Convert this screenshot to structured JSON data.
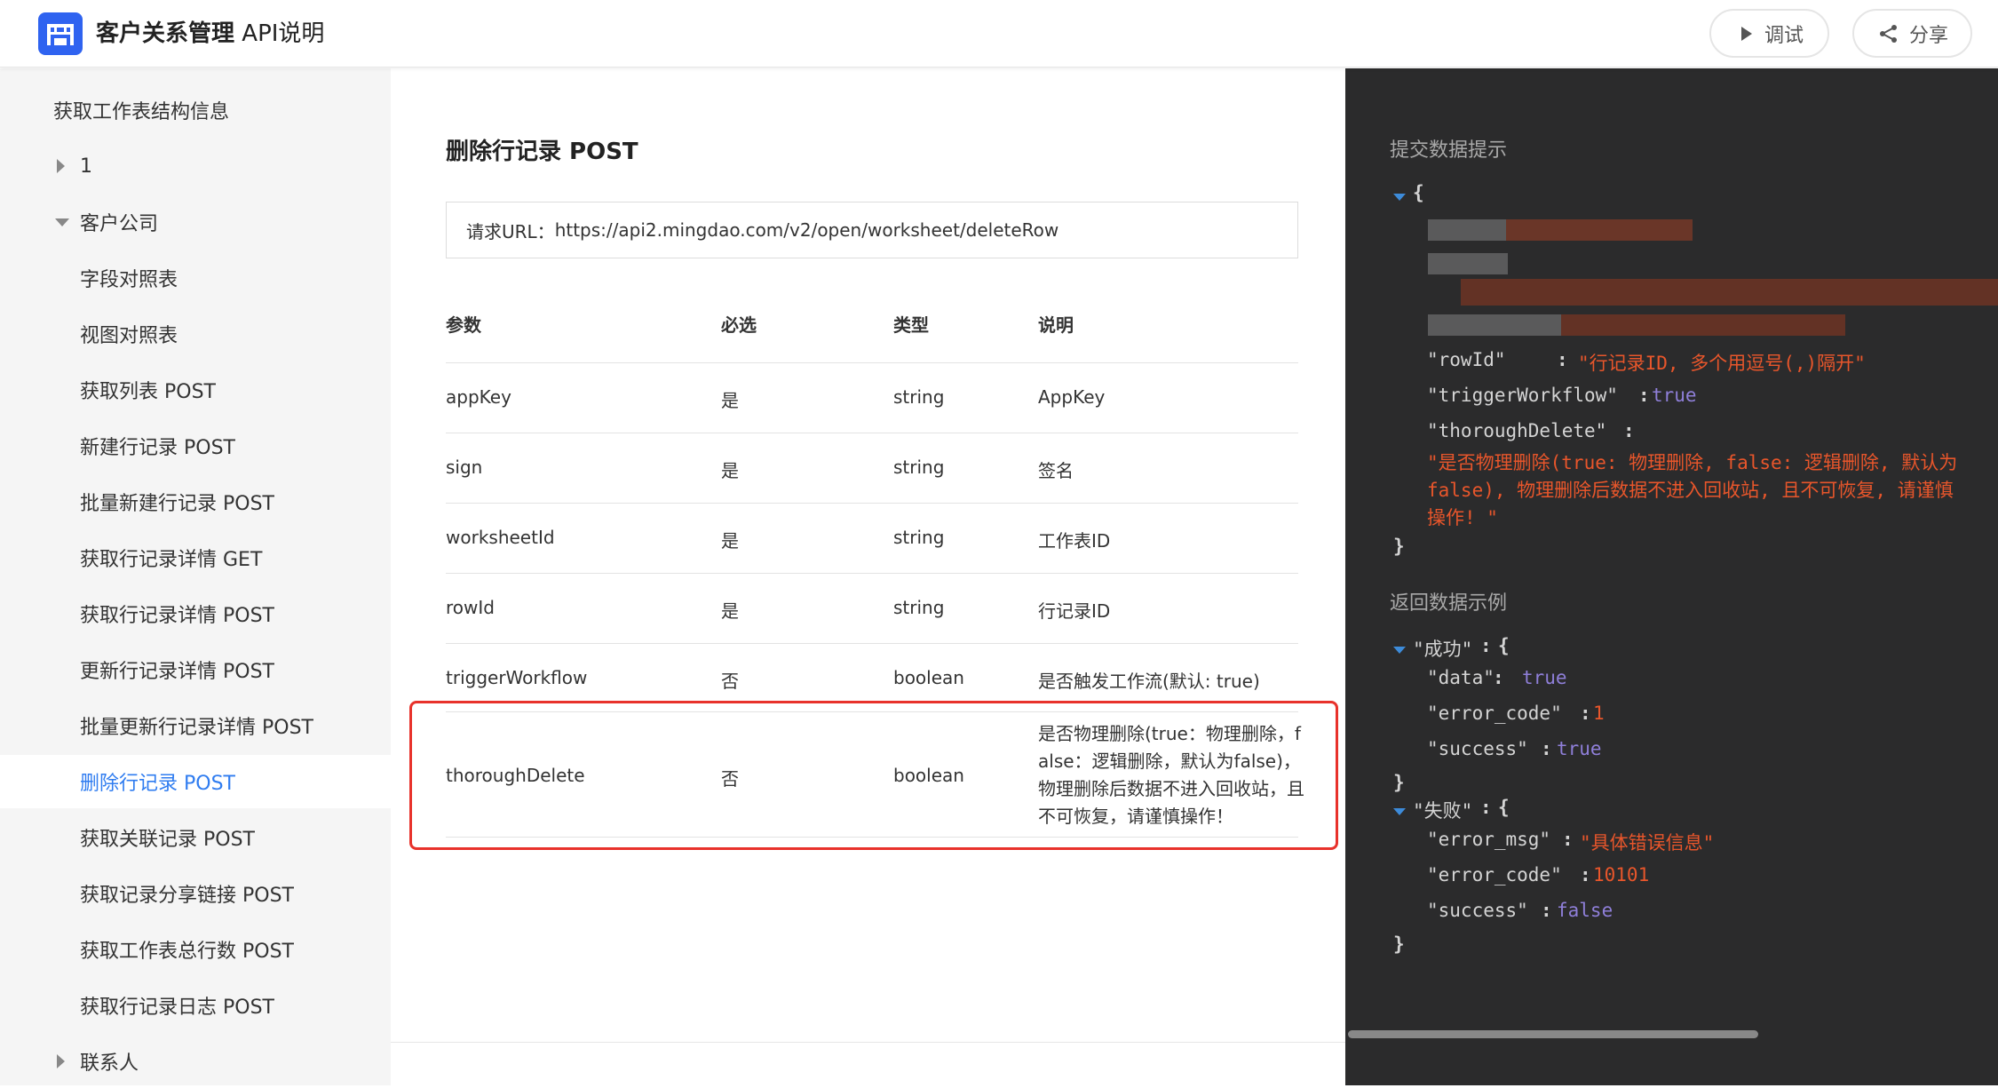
{
  "header": {
    "title_main": "客户关系管理",
    "title_sub": " API说明",
    "debug_label": "调试",
    "share_label": "分享"
  },
  "sidebar": {
    "items": [
      {
        "label": "获取工作表结构信息"
      },
      {
        "label": "1"
      },
      {
        "label": "客户公司"
      },
      {
        "label": "字段对照表"
      },
      {
        "label": "视图对照表"
      },
      {
        "label": "获取列表 POST"
      },
      {
        "label": "新建行记录 POST"
      },
      {
        "label": "批量新建行记录 POST"
      },
      {
        "label": "获取行记录详情 GET"
      },
      {
        "label": "获取行记录详情 POST"
      },
      {
        "label": "更新行记录详情 POST"
      },
      {
        "label": "批量更新行记录详情 POST"
      },
      {
        "label": "删除行记录 POST"
      },
      {
        "label": "获取关联记录 POST"
      },
      {
        "label": "获取记录分享链接 POST"
      },
      {
        "label": "获取工作表总行数 POST"
      },
      {
        "label": "获取行记录日志 POST"
      },
      {
        "label": "联系人"
      }
    ]
  },
  "main": {
    "title": "删除行记录 POST",
    "url_label": "请求URL：",
    "url": "https://api2.mingdao.com/v2/open/worksheet/deleteRow",
    "columns": [
      "参数",
      "必选",
      "类型",
      "说明"
    ],
    "rows": [
      {
        "param": "appKey",
        "required": "是",
        "type": "string",
        "desc": "AppKey"
      },
      {
        "param": "sign",
        "required": "是",
        "type": "string",
        "desc": "签名"
      },
      {
        "param": "worksheetId",
        "required": "是",
        "type": "string",
        "desc": "工作表ID"
      },
      {
        "param": "rowId",
        "required": "是",
        "type": "string",
        "desc": "行记录ID"
      },
      {
        "param": "triggerWorkflow",
        "required": "否",
        "type": "boolean",
        "desc": "是否触发工作流(默认: true)"
      },
      {
        "param": "thoroughDelete",
        "required": "否",
        "type": "boolean",
        "desc": "是否物理删除(true：物理删除，false：逻辑删除，默认为false)，物理删除后数据不进入回收站，且不可恢复，请谨慎操作！"
      }
    ]
  },
  "code": {
    "submit_label": "提交数据提示",
    "return_label": "返回数据示例",
    "submit": {
      "open": "{",
      "rowId_key": "\"rowId\"",
      "rowId_val": "\"行记录ID, 多个用逗号(,)隔开\"",
      "trigger_key": "\"triggerWorkflow\"",
      "trigger_val": "true",
      "thorough_key": "\"thoroughDelete\"",
      "thorough_val_1": "\"是否物理删除(true: 物理删除, false: 逻辑删除, 默认为",
      "thorough_val_2": "false), 物理删除后数据不进入回收站, 且不可恢复, 请谨慎",
      "thorough_val_3": "操作! \"",
      "close": "}"
    },
    "return": {
      "success_key": "\"成功\"",
      "data_key": "\"data\"",
      "data_val": "true",
      "error_code_key": "\"error_code\"",
      "error_code_val": "1",
      "success_flag_key": "\"success\"",
      "success_flag_val": "true",
      "fail_key": "\"失败\"",
      "error_msg_key": "\"error_msg\"",
      "error_msg_val": "\"具体错误信息\"",
      "fail_code_key": "\"error_code\"",
      "fail_code_val": "10101",
      "fail_flag_key": "\"success\"",
      "fail_flag_val": "false",
      "colon": ":",
      "open_brace": "{",
      "close_brace": "}"
    }
  },
  "colors": {
    "accent": "#2f7cf0",
    "brand": "#2f63f0",
    "highlight_border": "#e8322b",
    "code_bg": "#2b2b2c",
    "code_string": "#e8562b",
    "code_bool": "#8f7fd9"
  }
}
